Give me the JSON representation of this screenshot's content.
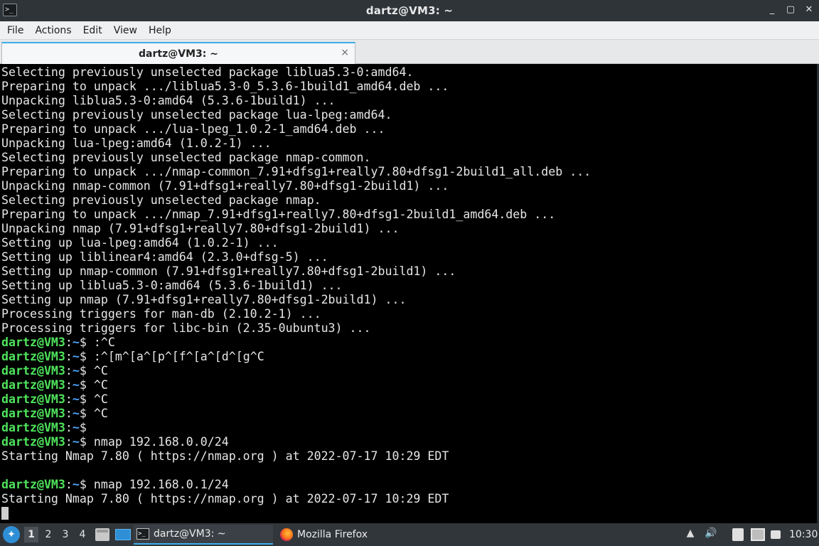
{
  "window": {
    "title": "dartz@VM3: ~",
    "controls": {
      "minimize": "_",
      "maximize": "▢",
      "close": "✕"
    }
  },
  "menu": [
    "File",
    "Actions",
    "Edit",
    "View",
    "Help"
  ],
  "tab": {
    "label": "dartz@VM3: ~",
    "close": "×"
  },
  "terminal": {
    "prompt": {
      "user": "dartz@VM3",
      "sep": ":",
      "path": "~",
      "symbol": "$"
    },
    "lines": [
      {
        "type": "out",
        "text": "Selecting previously unselected package liblua5.3-0:amd64."
      },
      {
        "type": "out",
        "text": "Preparing to unpack .../liblua5.3-0_5.3.6-1build1_amd64.deb ..."
      },
      {
        "type": "out",
        "text": "Unpacking liblua5.3-0:amd64 (5.3.6-1build1) ..."
      },
      {
        "type": "out",
        "text": "Selecting previously unselected package lua-lpeg:amd64."
      },
      {
        "type": "out",
        "text": "Preparing to unpack .../lua-lpeg_1.0.2-1_amd64.deb ..."
      },
      {
        "type": "out",
        "text": "Unpacking lua-lpeg:amd64 (1.0.2-1) ..."
      },
      {
        "type": "out",
        "text": "Selecting previously unselected package nmap-common."
      },
      {
        "type": "out",
        "text": "Preparing to unpack .../nmap-common_7.91+dfsg1+really7.80+dfsg1-2build1_all.deb ..."
      },
      {
        "type": "out",
        "text": "Unpacking nmap-common (7.91+dfsg1+really7.80+dfsg1-2build1) ..."
      },
      {
        "type": "out",
        "text": "Selecting previously unselected package nmap."
      },
      {
        "type": "out",
        "text": "Preparing to unpack .../nmap_7.91+dfsg1+really7.80+dfsg1-2build1_amd64.deb ..."
      },
      {
        "type": "out",
        "text": "Unpacking nmap (7.91+dfsg1+really7.80+dfsg1-2build1) ..."
      },
      {
        "type": "out",
        "text": "Setting up lua-lpeg:amd64 (1.0.2-1) ..."
      },
      {
        "type": "out",
        "text": "Setting up liblinear4:amd64 (2.3.0+dfsg-5) ..."
      },
      {
        "type": "out",
        "text": "Setting up nmap-common (7.91+dfsg1+really7.80+dfsg1-2build1) ..."
      },
      {
        "type": "out",
        "text": "Setting up liblua5.3-0:amd64 (5.3.6-1build1) ..."
      },
      {
        "type": "out",
        "text": "Setting up nmap (7.91+dfsg1+really7.80+dfsg1-2build1) ..."
      },
      {
        "type": "out",
        "text": "Processing triggers for man-db (2.10.2-1) ..."
      },
      {
        "type": "out",
        "text": "Processing triggers for libc-bin (2.35-0ubuntu3) ..."
      },
      {
        "type": "cmd",
        "text": " :^C"
      },
      {
        "type": "cmd",
        "text": " :^[m^[a^[p^[f^[a^[d^[g^C"
      },
      {
        "type": "cmd",
        "text": " ^C"
      },
      {
        "type": "cmd",
        "text": " ^C"
      },
      {
        "type": "cmd",
        "text": " ^C"
      },
      {
        "type": "cmd",
        "text": " ^C"
      },
      {
        "type": "cmd",
        "text": ""
      },
      {
        "type": "cmd",
        "text": " nmap 192.168.0.0/24"
      },
      {
        "type": "out",
        "text": "Starting Nmap 7.80 ( https://nmap.org ) at 2022-07-17 10:29 EDT"
      },
      {
        "type": "out",
        "text": ""
      },
      {
        "type": "cmd",
        "text": " nmap 192.168.0.1/24"
      },
      {
        "type": "out",
        "text": "Starting Nmap 7.80 ( https://nmap.org ) at 2022-07-17 10:29 EDT"
      },
      {
        "type": "cursor",
        "text": ""
      }
    ]
  },
  "taskbar": {
    "desktops": [
      "1",
      "2",
      "3",
      "4"
    ],
    "active_desktop": "1",
    "tasks": [
      {
        "label": "dartz@VM3: ~",
        "icon": "terminal-icon"
      },
      {
        "label": "Mozilla Firefox",
        "icon": "firefox-icon"
      }
    ],
    "clock": "10:30"
  },
  "colors": {
    "prompt_user": "#4fe35c",
    "prompt_path": "#4aa3ff",
    "accent": "#3daee9"
  }
}
